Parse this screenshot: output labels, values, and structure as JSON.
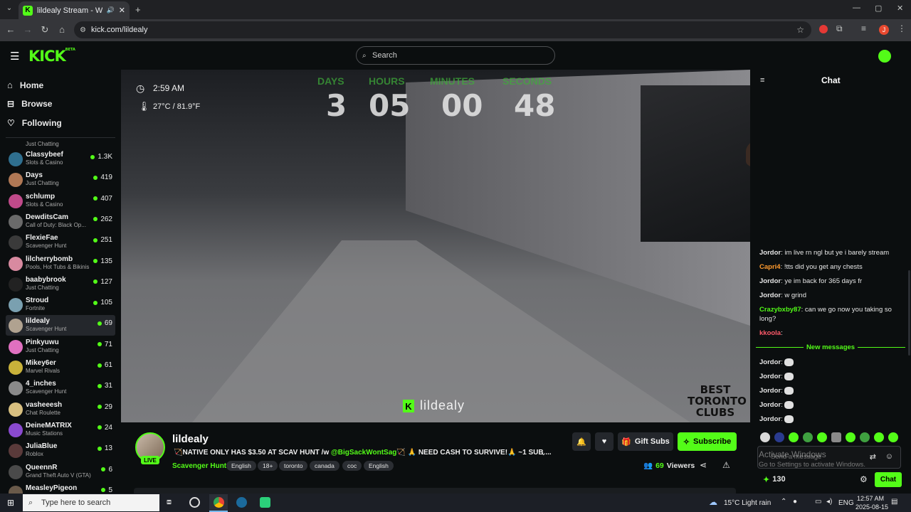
{
  "browser": {
    "tab_title": "lildealy Stream - Watch Live",
    "url": "kick.com/lildealy",
    "profile_initial": "J"
  },
  "header": {
    "logo": "KICK",
    "logo_badge": "BETA",
    "search_placeholder": "Search"
  },
  "sidebar": {
    "nav": [
      {
        "label": "Home",
        "icon": "home-icon"
      },
      {
        "label": "Browse",
        "icon": "compass-icon"
      },
      {
        "label": "Following",
        "icon": "heart-icon"
      }
    ],
    "partial_category": "Just Chatting",
    "channels": [
      {
        "name": "Classybeef",
        "category": "Slots & Casino",
        "viewers": "1.3K",
        "color": "#2f6f8f"
      },
      {
        "name": "Days",
        "category": "Just Chatting",
        "viewers": "419",
        "color": "#b07855"
      },
      {
        "name": "schlump",
        "category": "Slots & Casino",
        "viewers": "407",
        "color": "#c04a8a"
      },
      {
        "name": "DewditsCam",
        "category": "Call of Duty: Black Op...",
        "viewers": "262",
        "color": "#6a6a6a"
      },
      {
        "name": "FlexieFae",
        "category": "Scavenger Hunt",
        "viewers": "251",
        "color": "#3a3a3a"
      },
      {
        "name": "lilcherrybomb",
        "category": "Pools, Hot Tubs & Bikinis",
        "viewers": "135",
        "color": "#d88aa0"
      },
      {
        "name": "baabybrook",
        "category": "Just Chatting",
        "viewers": "127",
        "color": "#222"
      },
      {
        "name": "Stroud",
        "category": "Fortnite",
        "viewers": "105",
        "color": "#7aa0b0"
      },
      {
        "name": "lildealy",
        "category": "Scavenger Hunt",
        "viewers": "69",
        "color": "#b0a290",
        "active": true
      },
      {
        "name": "Pinkyuwu",
        "category": "Just Chatting",
        "viewers": "71",
        "color": "#e070c0"
      },
      {
        "name": "Mikey6er",
        "category": "Marvel Rivals",
        "viewers": "61",
        "color": "#c9b23a"
      },
      {
        "name": "4_inches",
        "category": "Scavenger Hunt",
        "viewers": "31",
        "color": "#8a8a8a"
      },
      {
        "name": "vasheeesh",
        "category": "Chat Roulette",
        "viewers": "29",
        "color": "#d8c080"
      },
      {
        "name": "DeineMATRIX",
        "category": "Music Stations",
        "viewers": "24",
        "color": "#8a4ad0"
      },
      {
        "name": "JuliaBlue",
        "category": "Roblox",
        "viewers": "13",
        "color": "#5a3a3a"
      },
      {
        "name": "QueennR",
        "category": "Grand Theft Auto V (GTA)",
        "viewers": "6",
        "color": "#4a4a4a"
      },
      {
        "name": "MeasleyPigeon",
        "category": "",
        "viewers": "5",
        "color": "#6a5a4a"
      }
    ]
  },
  "video": {
    "time": "2:59 AM",
    "temp": "27°C / 81.9°F",
    "countdown_labels": [
      "DAYS",
      "HOURS",
      "MINUTES",
      "SECONDS"
    ],
    "countdown_values": [
      "3",
      "05",
      "00",
      "48"
    ],
    "watermark_name": "lildealy",
    "sponsor_lines": [
      "BEST",
      "TORONTO",
      "CLUBS"
    ]
  },
  "stream": {
    "streamer": "lildealy",
    "live_badge": "LIVE",
    "title_pre": "🏹NATIVE ONLY HAS $3.50 AT SCAV HUNT  /w ",
    "title_mention": "@BigSackWontSag",
    "title_post": "🏹 🙏 NEED CASH TO SURVIVE!🙏 ~1 SUB ...",
    "category": "Scavenger Hunt",
    "tags": [
      "English",
      "18+",
      "toronto",
      "canada",
      "coc",
      "English"
    ],
    "gift_label": "Gift Subs",
    "subscribe_label": "Subscribe",
    "viewers": "69",
    "viewers_label": "Viewers"
  },
  "chat": {
    "title": "Chat",
    "messages": [
      {
        "user": "Jordor",
        "text": "im live rn ngl but ye i barely stream",
        "color": "#e6e6e6"
      },
      {
        "user": "Capri4",
        "text": "!tts did you get any chests",
        "color": "#ff9a2e"
      },
      {
        "user": "Jordor",
        "text": "ye im back for 365 days fr",
        "color": "#e6e6e6"
      },
      {
        "user": "Jordor",
        "text": "w grind",
        "color": "#e6e6e6"
      },
      {
        "user": "Crazybxby87",
        "text": "can we go now you taking so long?",
        "color": "#53fc18"
      },
      {
        "user": "kkoola",
        "text": "",
        "color": "#ff5a6a"
      }
    ],
    "new_messages_label": "New messages",
    "new_messages": [
      {
        "user": "Jordor",
        "text": ""
      },
      {
        "user": "Jordor",
        "text": ""
      },
      {
        "user": "Jordor",
        "text": ""
      },
      {
        "user": "Jordor",
        "text": ""
      },
      {
        "user": "Jordor",
        "text": ""
      }
    ],
    "input_placeholder": "Send a message",
    "activate_title": "Activate Windows",
    "activate_sub": "Go to Settings to activate Windows.",
    "points": "130",
    "send_label": "Chat"
  },
  "taskbar": {
    "search_placeholder": "Type here to search",
    "weather": "15°C  Light rain",
    "lang": "ENG",
    "time": "12:57 AM",
    "date": "2025-08-15"
  },
  "colors": {
    "accent": "#53fc18",
    "background": "#0b0e0f"
  }
}
